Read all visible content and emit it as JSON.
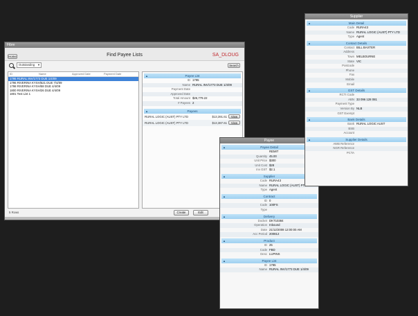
{
  "main_window": {
    "title": "Fibre",
    "home_label": "Home",
    "heading": "Find Payee Lists",
    "brand": "SA_DLOUG",
    "filter_value": "Outstanding",
    "search_label": "Search",
    "columns": [
      "ID",
      "Name",
      "Approved Date",
      "Payment Date"
    ],
    "rows": [
      {
        "text": "1795 RURAL INV/1773 DUE 1/4/09",
        "selected": true
      },
      {
        "text": "1796 RIVERINA KYSH/521 DUE 7/4/09",
        "selected": false
      },
      {
        "text": "1798 RIVERINA KYSH/58 DUE 4/4/09",
        "selected": false
      },
      {
        "text": "1800 RIVERINA KYSH/26 DUE 4/4/09",
        "selected": false
      },
      {
        "text": "1801 Test List 1",
        "selected": false
      }
    ],
    "status": "5 Rows",
    "payee_list": {
      "header": "Payee List",
      "fields": [
        {
          "label": "ID",
          "value": "1795"
        },
        {
          "label": "Name",
          "value": "RURAL INV/1773 DUE 1/4/09"
        },
        {
          "label": "Payment Date",
          "value": ""
        },
        {
          "label": "Approved Date",
          "value": ""
        },
        {
          "label": "Total Amount",
          "value": "$26,779.22"
        },
        {
          "label": "# Payees",
          "value": "2"
        }
      ]
    },
    "payees": {
      "header": "Payees",
      "items": [
        {
          "name": "RURAL LOGIC (AUST) PTY LTD",
          "amount": "$13,391.61",
          "button": "View"
        },
        {
          "name": "RURAL LOGIC (AUST) PTY LTD",
          "amount": "$13,387.61",
          "button": "View"
        }
      ]
    },
    "create_label": "Create",
    "edit_label": "Edit"
  },
  "payee_window": {
    "title": "Payee",
    "sections": [
      {
        "header": "Payee Detail",
        "fields": [
          {
            "label": "",
            "value": "REMIT"
          },
          {
            "label": "Quantity",
            "value": "45.00"
          },
          {
            "label": "Unit Price",
            "value": "$300"
          },
          {
            "label": "Unit Cost",
            "value": "$28"
          },
          {
            "label": "Inv GST",
            "value": "$2.1"
          }
        ]
      },
      {
        "header": "Supplier",
        "fields": [
          {
            "label": "Code",
            "value": "RURA43"
          },
          {
            "label": "Name",
            "value": "RURAL LOGIC (AUST) PTY LTD"
          },
          {
            "label": "Type",
            "value": "Agent"
          }
        ]
      },
      {
        "header": "Contract",
        "fields": [
          {
            "label": "ID",
            "value": "0"
          },
          {
            "label": "Code",
            "value": "100FS"
          },
          {
            "label": "Type",
            "value": ""
          }
        ]
      },
      {
        "header": "Delivery",
        "fields": [
          {
            "label": "Docket",
            "value": "DKT10384"
          },
          {
            "label": "Operation",
            "value": "Inbound"
          },
          {
            "label": "Date",
            "value": "21/12/2008 12:00:00 AM"
          },
          {
            "label": "Acc Period",
            "value": "200812"
          }
        ]
      },
      {
        "header": "Product",
        "fields": [
          {
            "label": "ID",
            "value": "25"
          },
          {
            "label": "Code",
            "value": "FBD"
          },
          {
            "label": "Desc",
            "value": "LUPINS"
          }
        ]
      },
      {
        "header": "Payee List",
        "fields": [
          {
            "label": "ID",
            "value": "1795"
          },
          {
            "label": "Name",
            "value": "RURAL INV/1773 DUE 1/4/09"
          }
        ]
      }
    ]
  },
  "supplier_window": {
    "title": "Supplier",
    "sections": [
      {
        "header": "Main Detail",
        "fields": [
          {
            "label": "Code",
            "value": "RURA43"
          },
          {
            "label": "Name",
            "value": "RURAL LOGIC (AUST) PTY LTD"
          },
          {
            "label": "Type",
            "value": "Agent"
          }
        ]
      },
      {
        "header": "Contact Details",
        "fields": [
          {
            "label": "Contact",
            "value": "BILL BAXTER"
          },
          {
            "label": "Address",
            "value": ""
          },
          {
            "label": "Town",
            "value": "MELBOURNE"
          },
          {
            "label": "State",
            "value": "VIC"
          },
          {
            "label": "Postcode",
            "value": ""
          },
          {
            "label": "Phone",
            "value": ""
          },
          {
            "label": "Fax",
            "value": ""
          },
          {
            "label": "Mobile",
            "value": ""
          },
          {
            "label": "Email",
            "value": ""
          }
        ]
      },
      {
        "header": "GST Details",
        "fields": [
          {
            "label": "RCTI Code",
            "value": ""
          },
          {
            "label": "ABN",
            "value": "33 096 128 081"
          },
          {
            "label": "Payment Type",
            "value": ""
          },
          {
            "label": "Version By",
            "value": "NLB"
          },
          {
            "label": "GST Exempt",
            "value": ""
          }
        ]
      },
      {
        "header": "Bank Details",
        "fields": [
          {
            "label": "Bank",
            "value": "RURAL LOGIC AUST"
          },
          {
            "label": "BSB",
            "value": ""
          },
          {
            "label": "Account",
            "value": ""
          }
        ]
      },
      {
        "header": "Supplier Details",
        "fields": [
          {
            "label": "AWB Reference",
            "value": ""
          },
          {
            "label": "NGR Reference",
            "value": ""
          },
          {
            "label": "PCTA",
            "value": ""
          }
        ]
      }
    ]
  }
}
